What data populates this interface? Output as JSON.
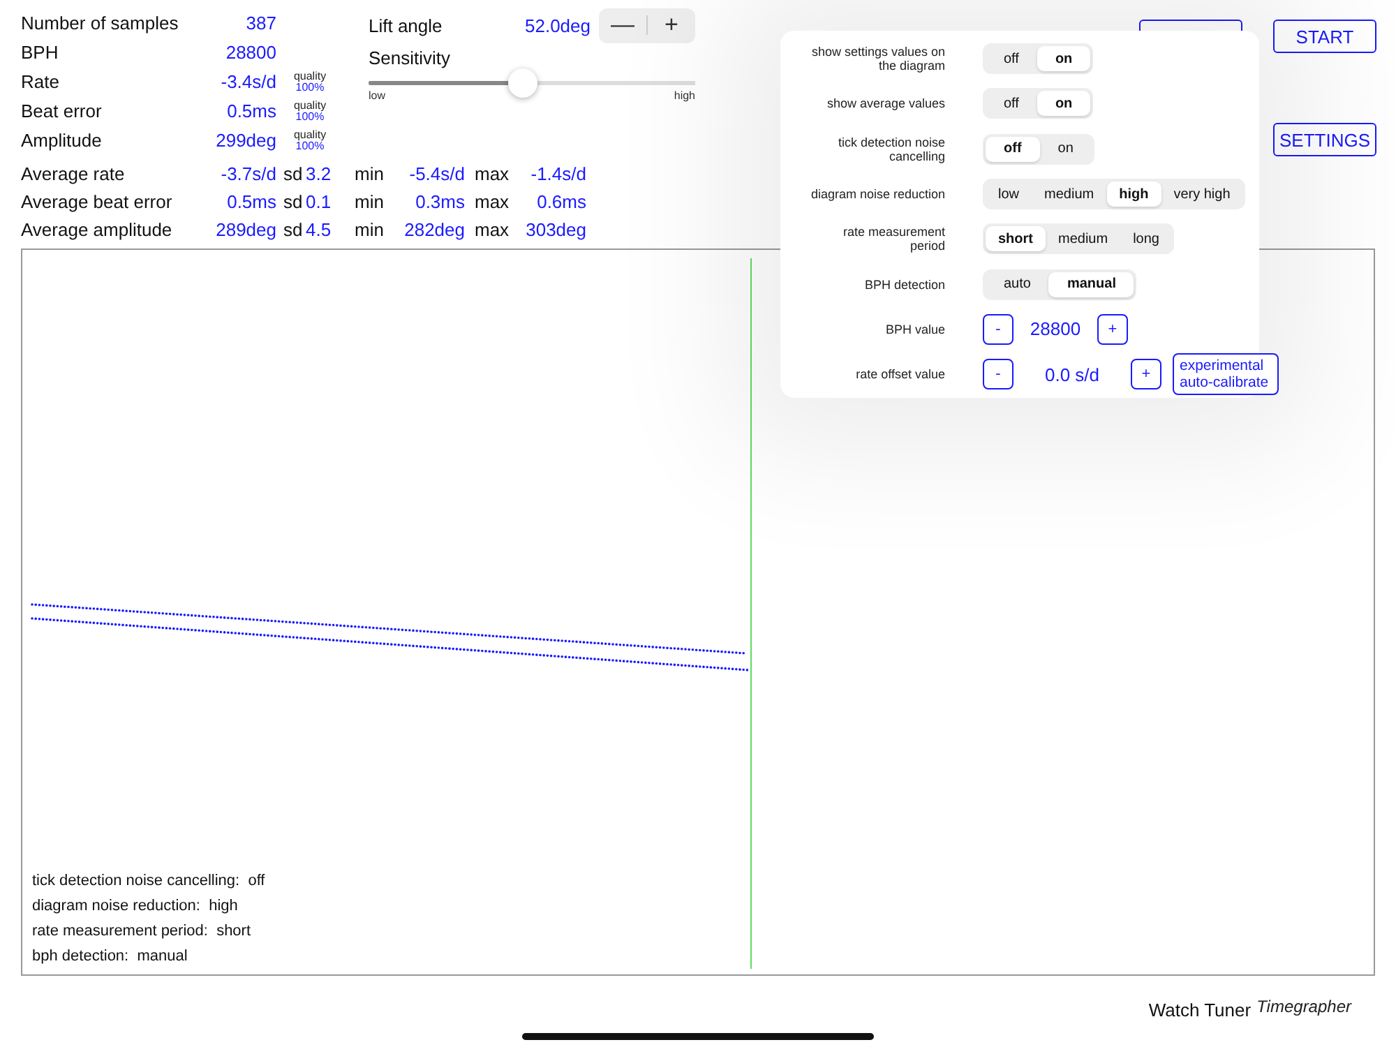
{
  "stats": [
    {
      "label": "Number of samples",
      "value": "387"
    },
    {
      "label": "BPH",
      "value": "28800"
    },
    {
      "label": "Rate",
      "value": "-3.4s/d",
      "quality_label": "quality",
      "quality": "100%"
    },
    {
      "label": "Beat error",
      "value": "0.5ms",
      "quality_label": "quality",
      "quality": "100%"
    },
    {
      "label": "Amplitude",
      "value": "299deg",
      "quality_label": "quality",
      "quality": "100%"
    }
  ],
  "averages": [
    {
      "label": "Average rate",
      "mean": "-3.7s/d",
      "sd_label": "sd",
      "sd": "3.2",
      "min_label": "min",
      "min": "-5.4s/d",
      "max_label": "max",
      "max": "-1.4s/d"
    },
    {
      "label": "Average beat error",
      "mean": "0.5ms",
      "sd_label": "sd",
      "sd": "0.1",
      "min_label": "min",
      "min": "0.3ms",
      "max_label": "max",
      "max": "0.6ms"
    },
    {
      "label": "Average amplitude",
      "mean": "289deg",
      "sd_label": "sd",
      "sd": "4.5",
      "min_label": "min",
      "min": "282deg",
      "max_label": "max",
      "max": "303deg"
    }
  ],
  "lift_angle": {
    "label": "Lift angle",
    "value": "52.0deg",
    "buttons": [
      "—",
      "+"
    ]
  },
  "sensitivity": {
    "label": "Sensitivity",
    "level": 0.47,
    "min_label": "low",
    "max_label": "high"
  },
  "buttons": [
    "START",
    "SETTINGS"
  ],
  "settings": {
    "rows": [
      {
        "kind": "segmented",
        "label": "show settings values on the diagram",
        "options": [
          {
            "label": "off",
            "selected": false
          },
          {
            "label": "on",
            "selected": true
          }
        ]
      },
      {
        "kind": "segmented",
        "label": "show average values",
        "options": [
          {
            "label": "off",
            "selected": false
          },
          {
            "label": "on",
            "selected": true
          }
        ]
      },
      {
        "kind": "segmented",
        "label": "tick detection noise cancelling",
        "options": [
          {
            "label": "off",
            "selected": true
          },
          {
            "label": "on",
            "selected": false
          }
        ]
      },
      {
        "kind": "segmented",
        "label": "diagram noise reduction",
        "options": [
          {
            "label": "low",
            "selected": false
          },
          {
            "label": "medium",
            "selected": false
          },
          {
            "label": "high",
            "selected": true
          },
          {
            "label": "very high",
            "selected": false
          }
        ]
      },
      {
        "kind": "segmented",
        "label": "rate measurement period",
        "options": [
          {
            "label": "short",
            "selected": true
          },
          {
            "label": "medium",
            "selected": false
          },
          {
            "label": "long",
            "selected": false
          }
        ]
      },
      {
        "kind": "segmented",
        "label": "BPH detection",
        "options": [
          {
            "label": "auto",
            "selected": false
          },
          {
            "label": "manual",
            "selected": true
          }
        ]
      },
      {
        "kind": "stepper",
        "label": "BPH value",
        "minus": "-",
        "value": "28800",
        "plus": "+"
      },
      {
        "kind": "stepper",
        "label": "rate offset value",
        "minus": "-",
        "value": "0.0 s/d",
        "plus": "+",
        "extra": "experimental auto-calibrate"
      }
    ]
  },
  "diagram": {
    "summary": [
      {
        "label": "tick detection noise cancelling:",
        "value": "off"
      },
      {
        "label": "diagram noise reduction:",
        "value": "high"
      },
      {
        "label": "rate measurement period:",
        "value": "short"
      },
      {
        "label": "bph detection:",
        "value": "manual"
      }
    ]
  },
  "footer": {
    "app_name": "Watch Tuner",
    "subtitle": "Timegrapher"
  }
}
